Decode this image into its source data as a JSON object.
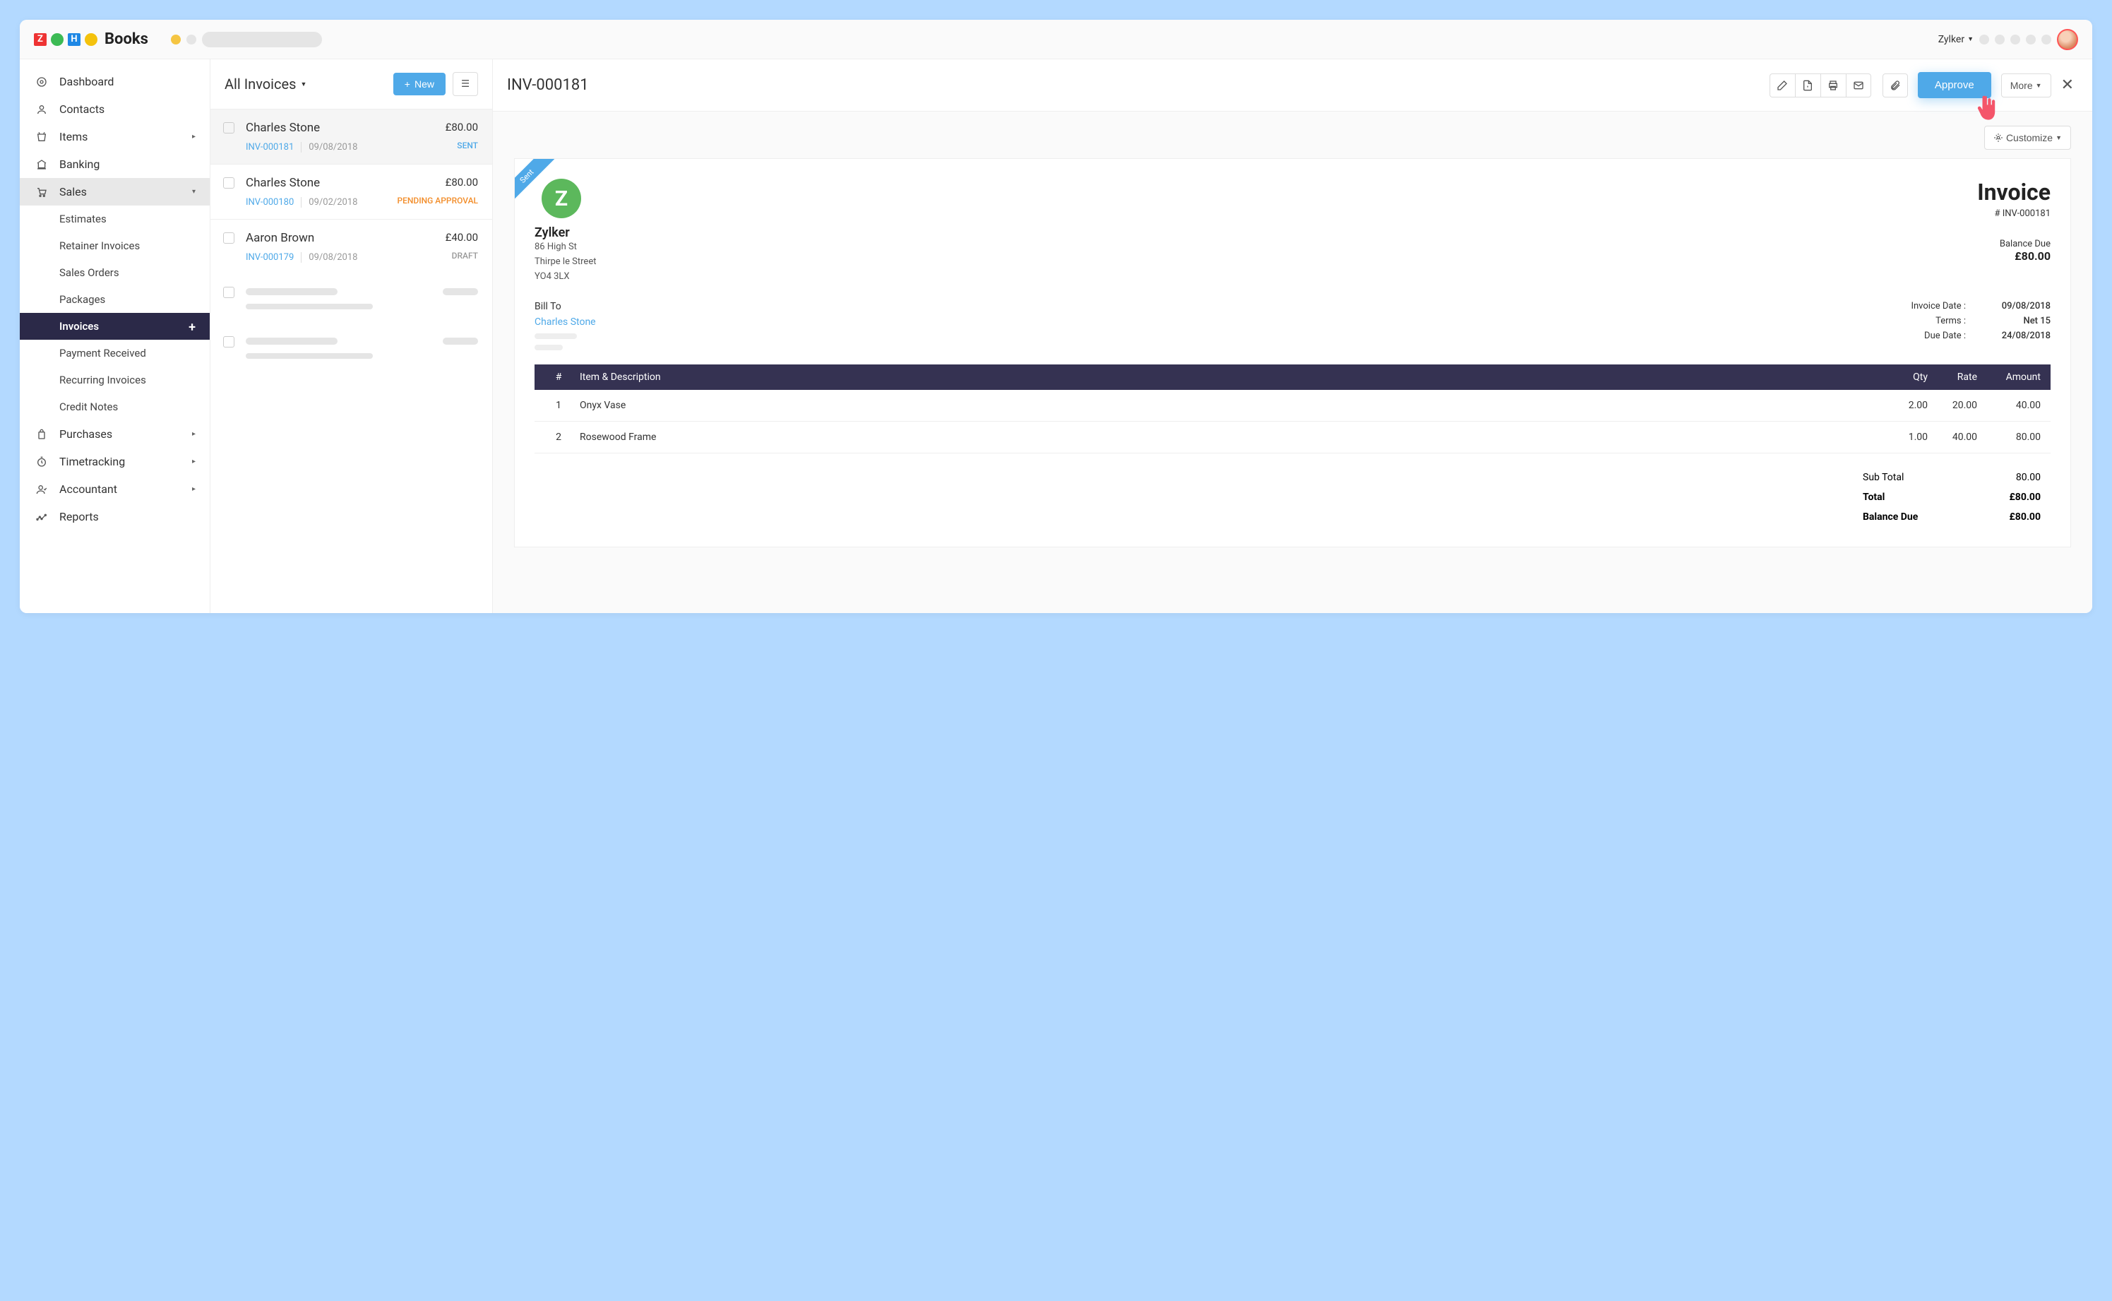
{
  "app_name": "Books",
  "org_name": "Zylker",
  "sidebar": {
    "items": [
      {
        "label": "Dashboard",
        "icon": "dashboard"
      },
      {
        "label": "Contacts",
        "icon": "contacts"
      },
      {
        "label": "Items",
        "icon": "items",
        "caret": true
      },
      {
        "label": "Banking",
        "icon": "banking"
      },
      {
        "label": "Sales",
        "icon": "sales",
        "expanded": true,
        "caret": true
      },
      {
        "label": "Purchases",
        "icon": "purchases",
        "caret": true
      },
      {
        "label": "Timetracking",
        "icon": "time",
        "caret": true
      },
      {
        "label": "Accountant",
        "icon": "accountant",
        "caret": true
      },
      {
        "label": "Reports",
        "icon": "reports"
      }
    ],
    "sales_sub": [
      {
        "label": "Estimates"
      },
      {
        "label": "Retainer Invoices"
      },
      {
        "label": "Sales Orders"
      },
      {
        "label": "Packages"
      },
      {
        "label": "Invoices",
        "active": true
      },
      {
        "label": "Payment Received"
      },
      {
        "label": "Recurring Invoices"
      },
      {
        "label": "Credit Notes"
      }
    ]
  },
  "list": {
    "title": "All Invoices",
    "new_label": "New",
    "rows": [
      {
        "name": "Charles Stone",
        "amount": "£80.00",
        "inv": "INV-000181",
        "date": "09/08/2018",
        "status": "SENT",
        "status_class": "sent",
        "selected": true
      },
      {
        "name": "Charles Stone",
        "amount": "£80.00",
        "inv": "INV-000180",
        "date": "09/02/2018",
        "status": "PENDING APPROVAL",
        "status_class": "pending"
      },
      {
        "name": "Aaron Brown",
        "amount": "£40.00",
        "inv": "INV-000179",
        "date": "09/08/2018",
        "status": "DRAFT",
        "status_class": "draft"
      }
    ]
  },
  "detail": {
    "title": "INV-000181",
    "approve_label": "Approve",
    "more_label": "More",
    "customize_label": "Customize",
    "ribbon": "Sent",
    "company": {
      "name": "Zylker",
      "addr1": "86 High St",
      "addr2": "Thirpe le Street",
      "addr3": "YO4 3LX"
    },
    "invoice_label": "Invoice",
    "invoice_number": "# INV-000181",
    "balance_due_label": "Balance Due",
    "balance_due": "£80.00",
    "bill_to_label": "Bill To",
    "bill_to_name": "Charles Stone",
    "meta": [
      {
        "label": "Invoice Date :",
        "value": "09/08/2018"
      },
      {
        "label": "Terms :",
        "value": "Net 15"
      },
      {
        "label": "Due Date :",
        "value": "24/08/2018"
      }
    ],
    "columns": {
      "num": "#",
      "desc": "Item & Description",
      "qty": "Qty",
      "rate": "Rate",
      "amount": "Amount"
    },
    "items": [
      {
        "num": "1",
        "desc": "Onyx Vase",
        "qty": "2.00",
        "rate": "20.00",
        "amount": "40.00"
      },
      {
        "num": "2",
        "desc": "Rosewood Frame",
        "qty": "1.00",
        "rate": "40.00",
        "amount": "80.00"
      }
    ],
    "totals": [
      {
        "label": "Sub Total",
        "value": "80.00",
        "bold": false
      },
      {
        "label": "Total",
        "value": "£80.00",
        "bold": true
      },
      {
        "label": "Balance Due",
        "value": "£80.00",
        "bold": true
      }
    ]
  }
}
